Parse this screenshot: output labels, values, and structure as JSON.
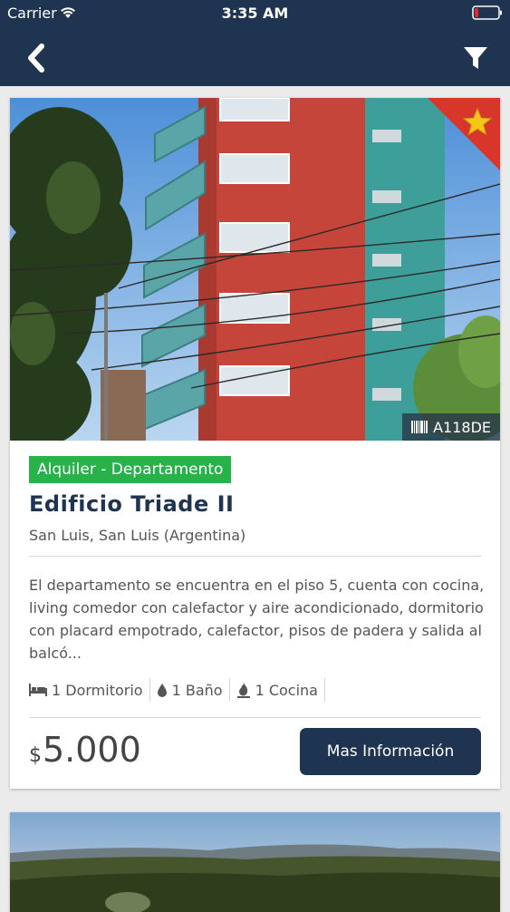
{
  "status_bar": {
    "carrier": "Carrier",
    "time": "3:35 AM"
  },
  "nav": {
    "back_icon": "chevron-left-icon",
    "filter_icon": "funnel-icon"
  },
  "colors": {
    "nav_background": "#1f3450",
    "category_badge": "#27b24a",
    "button_background": "#1f3450",
    "favorite_ribbon": "#d9362b",
    "favorite_star": "#f5c518"
  },
  "listings": [
    {
      "code": "A118DE",
      "category": "Alquiler - Departamento",
      "title": "Edificio Triade II",
      "location": "San Luis, San Luis (Argentina)",
      "description": "El departamento se encuentra en el piso 5, cuenta con cocina, living comedor con calefactor y aire acondicionado, dormitorio con placard empotrado, calefactor, pisos de padera y salida al balcó...",
      "features": {
        "bedrooms": "1 Dormitorio",
        "bathrooms": "1 Baño",
        "kitchens": "1 Cocina"
      },
      "price_currency": "$",
      "price_amount": "5.000",
      "button_label": "Mas Información",
      "favorite": true
    }
  ]
}
